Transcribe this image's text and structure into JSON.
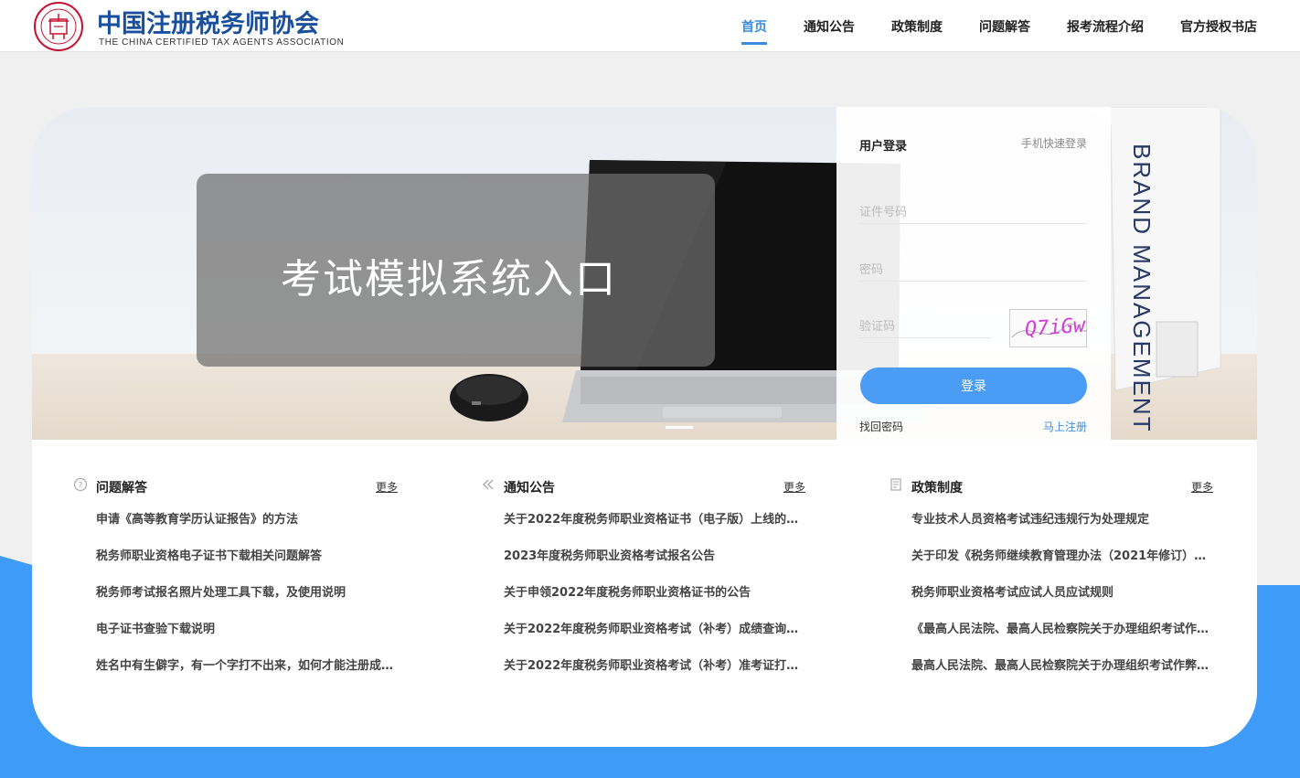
{
  "header": {
    "logo_cn": "中国注册税务师协会",
    "logo_en": "THE CHINA CERTIFIED TAX AGENTS ASSOCIATION",
    "nav": [
      {
        "label": "首页",
        "active": true
      },
      {
        "label": "通知公告",
        "active": false
      },
      {
        "label": "政策制度",
        "active": false
      },
      {
        "label": "问题解答",
        "active": false
      },
      {
        "label": "报考流程介绍",
        "active": false
      },
      {
        "label": "官方授权书店",
        "active": false
      }
    ]
  },
  "banner": {
    "title": "考试模拟系统入口",
    "book_text": "BRAND MANAGEMENT"
  },
  "login": {
    "title": "用户登录",
    "quick_login": "手机快速登录",
    "id_placeholder": "证件号码",
    "password_placeholder": "密码",
    "captcha_placeholder": "验证码",
    "captcha_text": "Q7iGw",
    "submit": "登录",
    "forgot": "找回密码",
    "register": "马上注册"
  },
  "sections": [
    {
      "title": "问题解答",
      "icon": "question-circle-icon",
      "more": "更多",
      "items": [
        "申请《高等教育学历认证报告》的方法",
        "税务师职业资格电子证书下载相关问题解答",
        "税务师考试报名照片处理工具下载，及使用说明",
        "电子证书查验下载说明",
        "姓名中有生僻字，有一个字打不出来，如何才能注册成…"
      ]
    },
    {
      "title": "通知公告",
      "icon": "double-chevron-left-icon",
      "more": "更多",
      "items": [
        "关于2022年度税务师职业资格证书（电子版）上线的…",
        "2023年度税务师职业资格考试报名公告",
        "关于申领2022年度税务师职业资格证书的公告",
        "关于2022年度税务师职业资格考试（补考）成绩查询…",
        "关于2022年度税务师职业资格考试（补考）准考证打…"
      ]
    },
    {
      "title": "政策制度",
      "icon": "document-icon",
      "more": "更多",
      "items": [
        "专业技术人员资格考试违纪违规行为处理规定",
        "关于印发《税务师继续教育管理办法（2021年修订）…",
        "税务师职业资格考试应试人员应试规则",
        "《最高人民法院、最高人民检察院关于办理组织考试作…",
        "最高人民法院、最高人民检察院关于办理组织考试作弊…"
      ]
    }
  ],
  "colors": {
    "accent": "#3c8ddb",
    "button": "#4a9cf5",
    "brand": "#1a4f9c",
    "seal": "#c8102e",
    "bottom_blue": "#3f9bf8"
  }
}
